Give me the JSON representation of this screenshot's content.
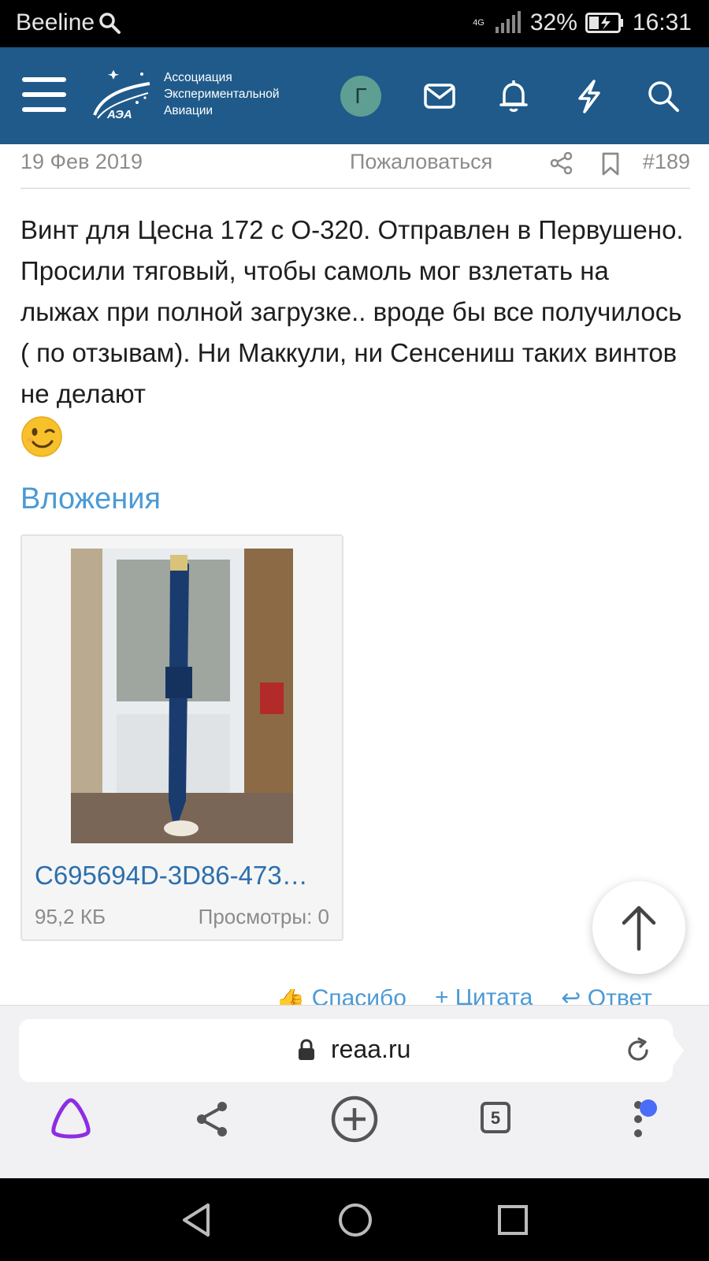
{
  "status_bar": {
    "carrier": "Beeline",
    "network": "4G",
    "battery": "32%",
    "time": "16:31"
  },
  "header": {
    "logo_lines": [
      "Ассоциация",
      "Экспериментальной",
      "Авиации"
    ],
    "logo_mark": "АЭА",
    "avatar_letter": "Г",
    "icons": [
      "menu-icon",
      "mail-icon",
      "bell-icon",
      "lightning-icon",
      "search-icon"
    ]
  },
  "post": {
    "date": "19 Фев 2019",
    "report_label": "Пожаловаться",
    "post_number": "#189",
    "text": "Винт для Цесна 172 с О-320. Отправлен в Первушено. Просили тяговый, чтобы самоль мог взлетать на лыжах при полной загрузке.. вроде бы все получилось ( по отзывам). Ни Маккули, ни Сенсениш таких винтов не делают",
    "emoji": "winking-face"
  },
  "attachments": {
    "title": "Вложения",
    "items": [
      {
        "name": "C695694D-3D86-473…",
        "size": "95,2 КБ",
        "views": "Просмотры: 0"
      }
    ]
  },
  "reactions": {
    "thanks": "Спасибо",
    "quote": "Цитата",
    "reply": "Ответ"
  },
  "browser": {
    "url": "reaa.ru",
    "tab_count": "5",
    "accent_color": "#8e2de2"
  }
}
